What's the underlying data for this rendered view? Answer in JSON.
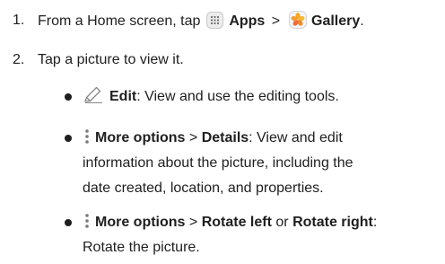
{
  "steps": [
    {
      "number": "1.",
      "prefix": "From a Home screen, tap",
      "apps_label": "Apps",
      "separator": ">",
      "gallery_label": "Gallery",
      "end": ".",
      "apps_icon": "apps-grid-icon",
      "gallery_icon": "gallery-flower-icon"
    },
    {
      "number": "2.",
      "text": "Tap a picture to view it."
    }
  ],
  "bullets": [
    {
      "icon": "pencil-icon",
      "label": "Edit",
      "desc": ": View and use the editing tools."
    },
    {
      "icon": "more-options-icon",
      "label": "More options",
      "separator": ">",
      "label2": "Details",
      "desc_line1": ": View and edit",
      "desc_line2": "information about the picture, including the",
      "desc_line3": "date created, location, and properties."
    },
    {
      "icon": "more-options-icon",
      "label": "More options",
      "separator": ">",
      "label2": "Rotate left",
      "or": "or",
      "label3": "Rotate right",
      "desc_line1": ":",
      "desc_line2": "Rotate the picture."
    }
  ],
  "colors": {
    "text": "#1f1f1f",
    "gallery_accent": "#f5a623",
    "apps_icon_bg": "#e8e8e8"
  }
}
